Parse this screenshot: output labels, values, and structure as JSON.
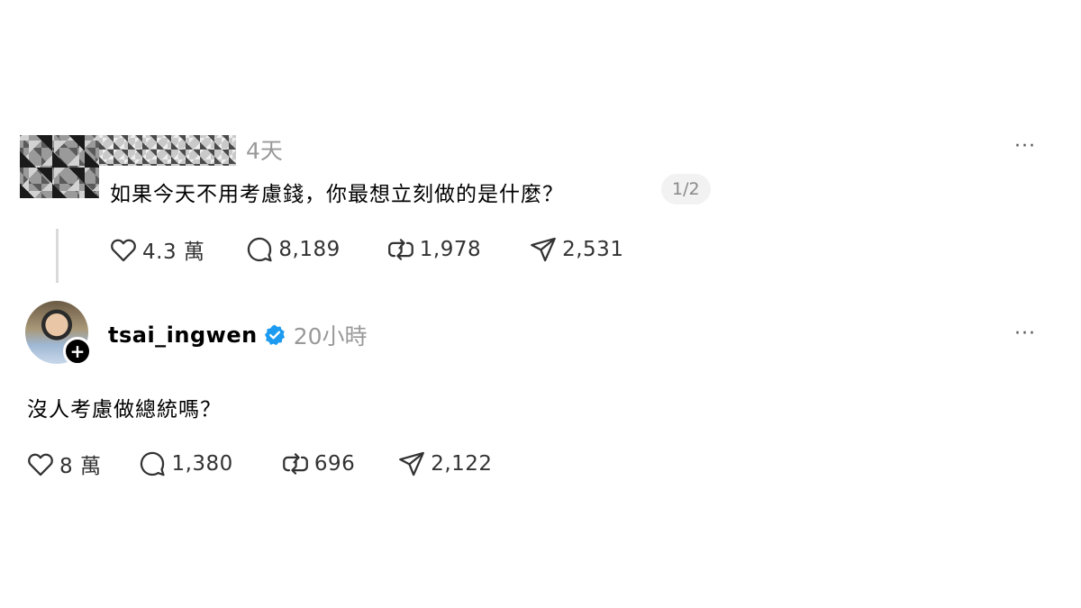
{
  "post1": {
    "timestamp": "4天",
    "text": "如果今天不用考慮錢，你最想立刻做的是什麼？",
    "counter": "1/2",
    "more": "···",
    "likes": "4.3 萬",
    "comments": "8,189",
    "reposts": "1,978",
    "shares": "2,531"
  },
  "post2": {
    "username": "tsai_ingwen",
    "timestamp": "20小時",
    "more": "···",
    "plus": "+",
    "text": "沒人考慮做總統嗎？",
    "likes": "8 萬",
    "comments": "1,380",
    "reposts": "696",
    "shares": "2,122"
  },
  "colors": {
    "verified": "#1d9bf0",
    "muted": "#999999",
    "icon": "#333333"
  },
  "icons": [
    "heart-icon",
    "comment-icon",
    "repost-icon",
    "share-icon",
    "verified-badge-icon",
    "more-icon",
    "plus-icon"
  ]
}
